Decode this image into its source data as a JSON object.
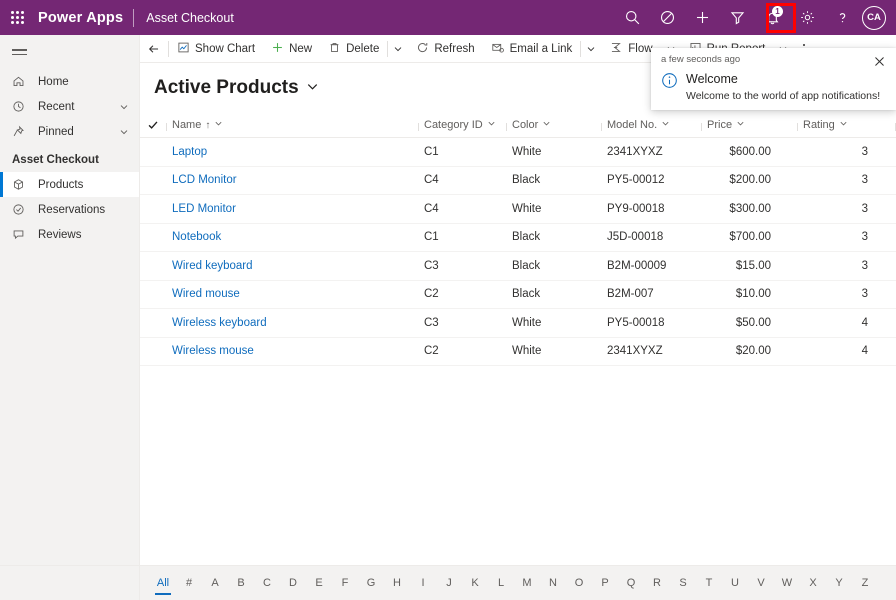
{
  "appbar": {
    "waffle_label": "app-launcher",
    "brand": "Power Apps",
    "app_name": "Asset Checkout",
    "icons": [
      {
        "name": "search-icon",
        "label": "Search"
      },
      {
        "name": "focus-mode-icon",
        "label": "Focused view"
      },
      {
        "name": "quick-create-icon",
        "label": "New"
      },
      {
        "name": "filter-icon",
        "label": "Filter"
      },
      {
        "name": "notifications-bell-icon",
        "label": "Notifications"
      },
      {
        "name": "settings-gear-icon",
        "label": "Settings"
      },
      {
        "name": "help-icon",
        "label": "Help"
      }
    ],
    "notification_badge": "1",
    "avatar_initials": "CA",
    "brand_color": "#742774",
    "highlight_color": "#ff0000"
  },
  "sidebar": {
    "hamburger_label": "Collapse navigation",
    "items": [
      {
        "label": "Home",
        "icon": "home-icon",
        "chevron": false,
        "selected": false
      },
      {
        "label": "Recent",
        "icon": "clock-icon",
        "chevron": true,
        "selected": false
      },
      {
        "label": "Pinned",
        "icon": "pin-icon",
        "chevron": true,
        "selected": false
      }
    ],
    "group_title": "Asset Checkout",
    "group_items": [
      {
        "label": "Products",
        "icon": "cube-icon",
        "selected": true
      },
      {
        "label": "Reservations",
        "icon": "check-circle-icon",
        "selected": false
      },
      {
        "label": "Reviews",
        "icon": "comment-icon",
        "selected": false
      }
    ],
    "selected_accent": "#0078d4"
  },
  "commandbar": {
    "back_label": "Back",
    "buttons": [
      {
        "label": "Show Chart",
        "icon": "chart-icon"
      },
      {
        "label": "New",
        "icon": "plus-icon"
      },
      {
        "label": "Delete",
        "icon": "trash-icon"
      },
      {
        "label": "Refresh",
        "icon": "refresh-icon"
      },
      {
        "label": "Email a Link",
        "icon": "email-link-icon"
      },
      {
        "label": "Flow",
        "icon": "flow-icon"
      },
      {
        "label": "Run Report",
        "icon": "report-icon"
      }
    ],
    "overflow_label": "More commands"
  },
  "view": {
    "title": "Active Products",
    "title_chevron": "chevron-down-icon"
  },
  "grid": {
    "select_all_label": "Select all",
    "columns": [
      {
        "label": "Name",
        "sorted": true,
        "sort_arrow": "↑"
      },
      {
        "label": "Category ID",
        "sorted": false,
        "sort_arrow": ""
      },
      {
        "label": "Color",
        "sorted": false,
        "sort_arrow": ""
      },
      {
        "label": "Model No.",
        "sorted": false,
        "sort_arrow": ""
      },
      {
        "label": "Price",
        "sorted": false,
        "sort_arrow": ""
      },
      {
        "label": "Rating",
        "sorted": false,
        "sort_arrow": ""
      }
    ],
    "rows": [
      {
        "name": "Laptop",
        "category": "C1",
        "color": "White",
        "model": "2341XYXZ",
        "price": "$600.00",
        "rating": "3"
      },
      {
        "name": "LCD Monitor",
        "category": "C4",
        "color": "Black",
        "model": "PY5-00012",
        "price": "$200.00",
        "rating": "3"
      },
      {
        "name": "LED Monitor",
        "category": "C4",
        "color": "White",
        "model": "PY9-00018",
        "price": "$300.00",
        "rating": "3"
      },
      {
        "name": "Notebook",
        "category": "C1",
        "color": "Black",
        "model": "J5D-00018",
        "price": "$700.00",
        "rating": "3"
      },
      {
        "name": "Wired keyboard",
        "category": "C3",
        "color": "Black",
        "model": "B2M-00009",
        "price": "$15.00",
        "rating": "3"
      },
      {
        "name": "Wired mouse",
        "category": "C2",
        "color": "Black",
        "model": "B2M-007",
        "price": "$10.00",
        "rating": "3"
      },
      {
        "name": "Wireless keyboard",
        "category": "C3",
        "color": "White",
        "model": "PY5-00018",
        "price": "$50.00",
        "rating": "4"
      },
      {
        "name": "Wireless mouse",
        "category": "C2",
        "color": "White",
        "model": "2341XYXZ",
        "price": "$20.00",
        "rating": "4"
      }
    ],
    "link_color": "#0f6cbd"
  },
  "alphabet_filter": {
    "active": "All",
    "items": [
      "All",
      "#",
      "A",
      "B",
      "C",
      "D",
      "E",
      "F",
      "G",
      "H",
      "I",
      "J",
      "K",
      "L",
      "M",
      "N",
      "O",
      "P",
      "Q",
      "R",
      "S",
      "T",
      "U",
      "V",
      "W",
      "X",
      "Y",
      "Z"
    ]
  },
  "notification": {
    "time": "a few seconds ago",
    "title": "Welcome",
    "message": "Welcome to the world of app notifications!",
    "close_label": "Dismiss",
    "icon": "info-circle-icon",
    "accent": "#0f6cbd"
  }
}
